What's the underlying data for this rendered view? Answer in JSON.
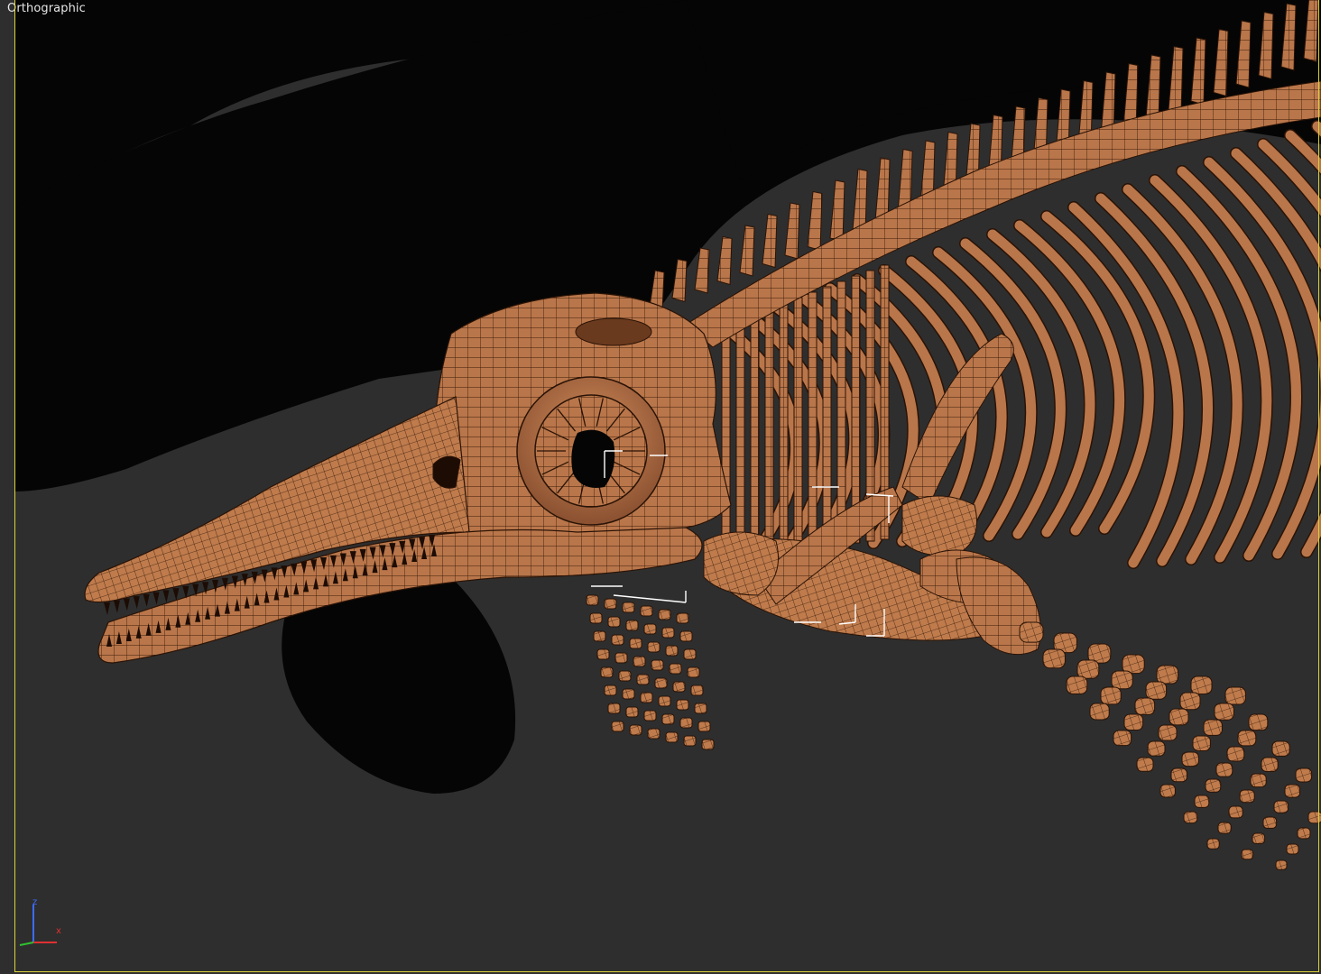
{
  "viewport": {
    "label": "Orthographic",
    "view_type": "orthographic",
    "shading": "smooth-with-edged-faces",
    "active_border_color": "#d8d23a",
    "background_color": "#2e2e2e",
    "shadow_color": "#050505"
  },
  "model": {
    "subject": "ichthyosaur-skeleton",
    "bone_color": "#b9764a",
    "bone_highlight_color": "#d08a58",
    "wire_color": "#1a0c04",
    "selection_bracket_color": "#ffffff"
  },
  "axis_gizmo": {
    "z_label": "z",
    "x_label": "x",
    "z_color": "#3c6cff",
    "x_color": "#e03030",
    "y_color": "#30c030"
  }
}
